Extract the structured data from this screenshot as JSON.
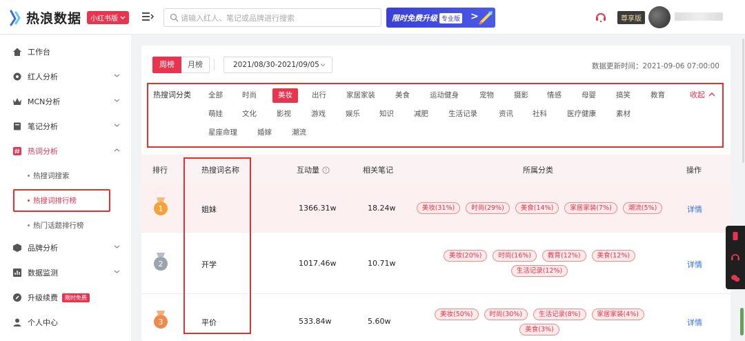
{
  "header": {
    "logo_text": "热浪数据",
    "app_tag": "小红书版",
    "search_placeholder": "请输入红人、笔记或品牌进行搜索",
    "promo_text": "限时免费升级",
    "promo_badge": "专业版",
    "vip_label": "尊享版"
  },
  "sidebar": {
    "items": [
      {
        "label": "工作台",
        "icon": "home-icon"
      },
      {
        "label": "红人分析",
        "icon": "settings-icon"
      },
      {
        "label": "MCN分析",
        "icon": "crown-icon"
      },
      {
        "label": "笔记分析",
        "icon": "book-icon"
      },
      {
        "label": "热词分析",
        "icon": "hashtag-icon"
      },
      {
        "label": "品牌分析",
        "icon": "cube-icon"
      },
      {
        "label": "数据监测",
        "icon": "chart-icon"
      },
      {
        "label": "升级续费",
        "icon": "rocket-icon",
        "tag": "限时免费"
      },
      {
        "label": "个人中心",
        "icon": "user-icon"
      }
    ],
    "sub_items": [
      "热搜词搜索",
      "热搜词排行榜",
      "热门话题排行榜"
    ]
  },
  "toolbar": {
    "tab_week": "周榜",
    "tab_month": "月榜",
    "date_range": "2021/08/30-2021/09/05",
    "update_time": "数据更新时间：2021-09-06 07:00:00"
  },
  "categories": {
    "title": "热搜词分类",
    "collapse_label": "收起",
    "selected": "美妆",
    "rows": [
      [
        "全部",
        "时尚",
        "美妆",
        "出行",
        "家居家装",
        "美食",
        "运动健身",
        "宠物",
        "摄影",
        "情感",
        "母婴",
        "搞笑",
        "教育"
      ],
      [
        "萌娃",
        "文化",
        "影视",
        "游戏",
        "娱乐",
        "知识",
        "减肥",
        "生活记录",
        "资讯",
        "社科",
        "医疗健康",
        "素材"
      ],
      [
        "星座命理",
        "婚嫁",
        "潮流"
      ]
    ]
  },
  "table": {
    "headers": {
      "rank": "排行",
      "keyword": "热搜词名称",
      "interactions": "互动量",
      "notes": "相关笔记",
      "category": "所属分类",
      "action": "操作"
    },
    "rows": [
      {
        "rank": "1",
        "medal_color": "#f2a43a",
        "keyword": "姐妹",
        "interactions": "1366.31w",
        "notes": "18.24w",
        "tags": [
          "美妆(31%)",
          "时尚(29%)",
          "美食(14%)",
          "家居家装(7%)",
          "潮流(5%)"
        ],
        "action": "详情"
      },
      {
        "rank": "2",
        "medal_color": "#9aa3ae",
        "keyword": "开学",
        "interactions": "1017.46w",
        "notes": "10.71w",
        "tags": [
          "美妆(20%)",
          "时尚(16%)",
          "教育(12%)",
          "美食(12%)",
          "生活记录(12%)"
        ],
        "action": "详情"
      },
      {
        "rank": "3",
        "medal_color": "#f08a4b",
        "keyword": "平价",
        "interactions": "533.84w",
        "notes": "5.60w",
        "tags": [
          "美妆(50%)",
          "时尚(30%)",
          "生活记录(8%)",
          "家居家装(4%)",
          "美食(3%)"
        ],
        "action": "详情"
      }
    ]
  }
}
